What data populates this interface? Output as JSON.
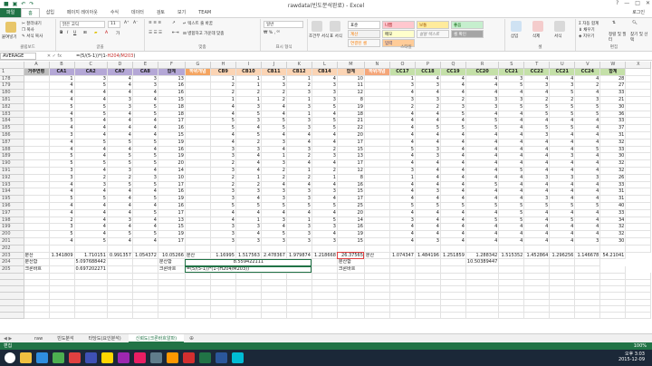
{
  "window": {
    "title": "rawdata(빈도분석완료) - Excel",
    "login": "로그인"
  },
  "ribbon_tabs": [
    "파일",
    "홈",
    "삽입",
    "페이지 레이아웃",
    "수식",
    "데이터",
    "검토",
    "보기",
    "TEAM"
  ],
  "ribbon": {
    "clipboard": {
      "label": "클립보드",
      "paste": "붙여넣기",
      "cut": "잘라내기",
      "copy": "복사",
      "format_painter": "서식 복사"
    },
    "font": {
      "label": "글꼴",
      "name": "맑은 고딕",
      "size": "11"
    },
    "align": {
      "label": "맞춤",
      "wrap": "텍스트 줄 바꿈",
      "merge": "병합하고 가운데 맞춤"
    },
    "number": {
      "label": "표시 형식",
      "format": "일반"
    },
    "styles": {
      "label": "스타일",
      "conditional": "조건부 서식",
      "table": "표 서식",
      "normal": "표준",
      "bad": "나쁨",
      "good": "보통",
      "neutral": "좋음",
      "calc": "계산",
      "check": "메모",
      "explain": "설명 텍스트",
      "input": "셀 확인",
      "linked": "연결된 셀",
      "output": "입력"
    },
    "cells": {
      "label": "셀",
      "insert": "삽입",
      "delete": "삭제",
      "format": "서식"
    },
    "editing": {
      "label": "편집",
      "autosum": "자동 합계",
      "fill": "채우기",
      "clear": "지우기",
      "sort": "정렬 및 필터",
      "find": "찾기 및 선택"
    }
  },
  "formula_bar": {
    "name_box": "AVERAGE",
    "cancel": "✕",
    "enter": "✓",
    "fx": "fx",
    "formula_prefix": "=(5/(5-1))*(1-",
    "ref1": "H204",
    "sep": "/",
    "ref2": "M203",
    "formula_suffix": ")"
  },
  "columns": [
    "A",
    "B",
    "C",
    "D",
    "E",
    "F",
    "G",
    "H",
    "I",
    "J",
    "K",
    "L",
    "M",
    "N",
    "O",
    "P",
    "Q",
    "R",
    "S",
    "T",
    "U",
    "V",
    "W",
    "X"
  ],
  "header_row": {
    "row": "1",
    "cells": [
      "거주연령",
      "CA1",
      "CA2",
      "CA7",
      "CA8",
      "합계",
      "하위개념",
      "CB9",
      "CB10",
      "CB11",
      "CB12",
      "CB14",
      "합계",
      "하위개념",
      "CC17",
      "CC18",
      "CC19",
      "CC20",
      "CC21",
      "CC22",
      "CC21",
      "CC24",
      "합계",
      ""
    ]
  },
  "rows": [
    {
      "n": "178",
      "v": [
        "",
        "1",
        "3",
        "4",
        "3",
        "13",
        "",
        "1",
        "1",
        "3",
        "1",
        "4",
        "10",
        "",
        "1",
        "4",
        "4",
        "4",
        "3",
        "4",
        "4",
        "4",
        "28"
      ]
    },
    {
      "n": "179",
      "v": [
        "",
        "4",
        "5",
        "4",
        "3",
        "16",
        "",
        "2",
        "1",
        "3",
        "2",
        "3",
        "11",
        "",
        "3",
        "3",
        "4",
        "4",
        "5",
        "3",
        "3",
        "2",
        "27"
      ]
    },
    {
      "n": "180",
      "v": [
        "",
        "4",
        "4",
        "4",
        "4",
        "16",
        "",
        "2",
        "2",
        "2",
        "3",
        "3",
        "12",
        "",
        "4",
        "4",
        "4",
        "4",
        "4",
        "4",
        "5",
        "4",
        "33"
      ]
    },
    {
      "n": "181",
      "v": [
        "",
        "4",
        "4",
        "3",
        "4",
        "15",
        "",
        "1",
        "1",
        "2",
        "1",
        "3",
        "8",
        "",
        "3",
        "3",
        "2",
        "3",
        "3",
        "2",
        "2",
        "3",
        "21"
      ]
    },
    {
      "n": "182",
      "v": [
        "",
        "5",
        "5",
        "3",
        "5",
        "18",
        "",
        "4",
        "3",
        "4",
        "3",
        "5",
        "19",
        "",
        "2",
        "2",
        "3",
        "3",
        "5",
        "5",
        "5",
        "5",
        "30"
      ]
    },
    {
      "n": "183",
      "v": [
        "",
        "4",
        "5",
        "4",
        "5",
        "18",
        "",
        "4",
        "5",
        "4",
        "1",
        "4",
        "18",
        "",
        "4",
        "4",
        "5",
        "4",
        "4",
        "5",
        "5",
        "5",
        "36"
      ]
    },
    {
      "n": "184",
      "v": [
        "",
        "5",
        "4",
        "4",
        "4",
        "17",
        "",
        "5",
        "3",
        "5",
        "3",
        "5",
        "21",
        "",
        "4",
        "4",
        "4",
        "5",
        "4",
        "4",
        "4",
        "4",
        "33"
      ]
    },
    {
      "n": "185",
      "v": [
        "",
        "4",
        "4",
        "4",
        "4",
        "16",
        "",
        "5",
        "4",
        "5",
        "3",
        "5",
        "22",
        "",
        "4",
        "5",
        "5",
        "5",
        "4",
        "5",
        "5",
        "4",
        "37"
      ]
    },
    {
      "n": "186",
      "v": [
        "",
        "3",
        "4",
        "4",
        "4",
        "15",
        "",
        "4",
        "5",
        "4",
        "4",
        "4",
        "20",
        "",
        "4",
        "4",
        "4",
        "4",
        "4",
        "3",
        "4",
        "4",
        "31"
      ]
    },
    {
      "n": "187",
      "v": [
        "",
        "4",
        "5",
        "5",
        "5",
        "19",
        "",
        "4",
        "2",
        "3",
        "4",
        "4",
        "17",
        "",
        "4",
        "4",
        "4",
        "4",
        "4",
        "4",
        "4",
        "4",
        "32"
      ]
    },
    {
      "n": "188",
      "v": [
        "",
        "4",
        "4",
        "4",
        "4",
        "16",
        "",
        "3",
        "3",
        "4",
        "3",
        "2",
        "15",
        "",
        "5",
        "3",
        "4",
        "4",
        "4",
        "4",
        "4",
        "5",
        "33"
      ]
    },
    {
      "n": "189",
      "v": [
        "",
        "5",
        "4",
        "5",
        "5",
        "19",
        "",
        "3",
        "4",
        "1",
        "2",
        "3",
        "13",
        "",
        "4",
        "3",
        "4",
        "4",
        "4",
        "4",
        "3",
        "4",
        "30"
      ]
    },
    {
      "n": "190",
      "v": [
        "",
        "5",
        "5",
        "5",
        "5",
        "20",
        "",
        "2",
        "4",
        "3",
        "4",
        "4",
        "17",
        "",
        "4",
        "4",
        "4",
        "4",
        "4",
        "4",
        "4",
        "4",
        "32"
      ]
    },
    {
      "n": "191",
      "v": [
        "",
        "3",
        "4",
        "3",
        "4",
        "14",
        "",
        "3",
        "4",
        "2",
        "1",
        "2",
        "12",
        "",
        "3",
        "4",
        "4",
        "4",
        "5",
        "4",
        "4",
        "4",
        "32"
      ]
    },
    {
      "n": "192",
      "v": [
        "",
        "3",
        "2",
        "2",
        "3",
        "10",
        "",
        "2",
        "1",
        "2",
        "2",
        "1",
        "8",
        "",
        "1",
        "4",
        "4",
        "4",
        "4",
        "3",
        "3",
        "3",
        "26"
      ]
    },
    {
      "n": "193",
      "v": [
        "",
        "4",
        "3",
        "5",
        "5",
        "17",
        "",
        "2",
        "2",
        "4",
        "4",
        "4",
        "16",
        "",
        "4",
        "4",
        "4",
        "5",
        "4",
        "4",
        "4",
        "4",
        "33"
      ]
    },
    {
      "n": "194",
      "v": [
        "",
        "4",
        "4",
        "4",
        "4",
        "16",
        "",
        "3",
        "3",
        "3",
        "3",
        "3",
        "15",
        "",
        "4",
        "3",
        "4",
        "4",
        "4",
        "4",
        "4",
        "4",
        "31"
      ]
    },
    {
      "n": "195",
      "v": [
        "",
        "5",
        "5",
        "4",
        "5",
        "19",
        "",
        "3",
        "4",
        "3",
        "3",
        "4",
        "17",
        "",
        "4",
        "4",
        "4",
        "4",
        "4",
        "3",
        "4",
        "4",
        "31"
      ]
    },
    {
      "n": "196",
      "v": [
        "",
        "4",
        "4",
        "4",
        "4",
        "16",
        "",
        "5",
        "5",
        "5",
        "5",
        "5",
        "25",
        "",
        "5",
        "5",
        "5",
        "5",
        "5",
        "5",
        "5",
        "5",
        "40"
      ]
    },
    {
      "n": "197",
      "v": [
        "",
        "4",
        "4",
        "4",
        "5",
        "17",
        "",
        "4",
        "4",
        "4",
        "4",
        "4",
        "20",
        "",
        "4",
        "4",
        "4",
        "4",
        "5",
        "4",
        "4",
        "4",
        "33"
      ]
    },
    {
      "n": "198",
      "v": [
        "",
        "2",
        "4",
        "3",
        "4",
        "13",
        "",
        "4",
        "1",
        "3",
        "1",
        "5",
        "14",
        "",
        "3",
        "4",
        "4",
        "5",
        "5",
        "4",
        "5",
        "4",
        "34"
      ]
    },
    {
      "n": "199",
      "v": [
        "",
        "3",
        "4",
        "4",
        "4",
        "15",
        "",
        "3",
        "3",
        "4",
        "3",
        "3",
        "16",
        "",
        "4",
        "4",
        "4",
        "4",
        "4",
        "4",
        "4",
        "4",
        "32"
      ]
    },
    {
      "n": "200",
      "v": [
        "",
        "5",
        "4",
        "5",
        "5",
        "19",
        "",
        "3",
        "4",
        "5",
        "3",
        "4",
        "19",
        "",
        "4",
        "4",
        "4",
        "4",
        "4",
        "4",
        "4",
        "4",
        "32"
      ]
    },
    {
      "n": "201",
      "v": [
        "",
        "4",
        "5",
        "4",
        "4",
        "17",
        "",
        "3",
        "3",
        "3",
        "3",
        "3",
        "15",
        "",
        "4",
        "3",
        "4",
        "4",
        "4",
        "4",
        "4",
        "3",
        "30"
      ]
    }
  ],
  "summary": {
    "r202": "202",
    "r203": {
      "n": "203",
      "label": "분산",
      "v1": "1.341809",
      "v2": "1.710151",
      "v3": "0.991357",
      "v4": "1.054372",
      "v5": "10.05266",
      "label2": "분산",
      "w1": "1.16995",
      "w2": "1.517563",
      "w3": "2.478367",
      "w4": "1.979874",
      "w5": "1.218668",
      "w6": "26.37565",
      "label3": "분산",
      "x1": "1.074347",
      "x2": "1.484196",
      "x3": "1.251859",
      "x4": "1.288342",
      "x5": "1.515352",
      "x6": "1.452864",
      "x7": "1.296256",
      "x8": "1.146678",
      "x9": "54.21041"
    },
    "r204": {
      "n": "204",
      "label": "분산합",
      "v": "5.097688442",
      "label2": "분산합",
      "w": "8.559422111",
      "label3": "분산합",
      "x": "10.50389447"
    },
    "r205": {
      "n": "205",
      "label": "크론바흐",
      "v": "0.697202271",
      "label2": "크론바흐",
      "w": "=(5/(5-1))*(1-(H204/M203))",
      "label3": "크론바흐"
    }
  },
  "sheets": [
    "raw",
    "빈도분석",
    "타당도(요인분석)",
    "신뢰도(크론바흐알파)"
  ],
  "active_sheet": 3,
  "status": {
    "mode": "편집",
    "zoom": "100%"
  },
  "clock": {
    "time": "오후 3:03",
    "date": "2015-12-09"
  }
}
